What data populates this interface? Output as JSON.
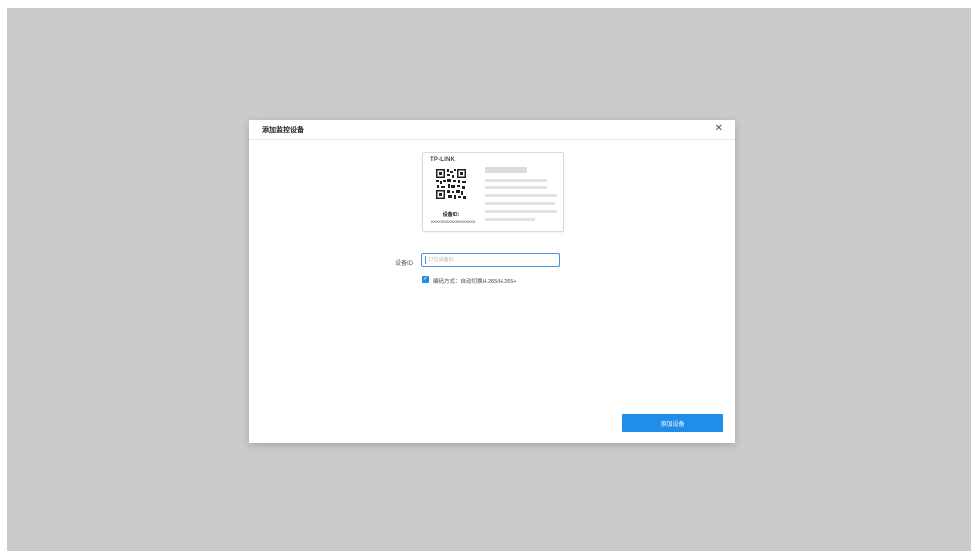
{
  "dialog": {
    "title": "添加监控设备",
    "close_icon": "close-icon",
    "device_label": {
      "brand": "TP-LINK",
      "id_caption": "设备ID:",
      "id_value": "XXXXXXXXXXXXXXXXXX",
      "qr_icon": "qr-code-icon"
    },
    "device_id_field": {
      "label": "设备ID",
      "value": "",
      "placeholder": "17位设备ID"
    },
    "encoding_checkbox": {
      "checked": true,
      "label": "编码方式：自动切换H.265/H.265+"
    },
    "submit_label": "添加设备"
  },
  "colors": {
    "accent": "#1e8ee8",
    "backdrop": "#cbcbcb"
  }
}
